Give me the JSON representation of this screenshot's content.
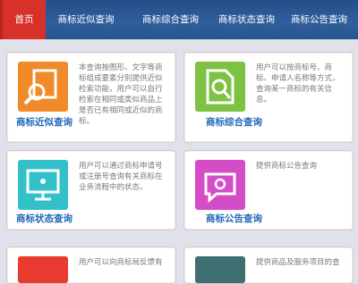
{
  "nav": {
    "items": [
      {
        "label": "首页",
        "active": true
      },
      {
        "label": "商标近似查询"
      },
      {
        "label": "商标综合查询"
      },
      {
        "label": "商标状态查询"
      },
      {
        "label": "商标公告查询"
      }
    ]
  },
  "cards": [
    {
      "title": "商标近似查询",
      "icon": "search-document-icon",
      "color": "#f18a28",
      "desc": "本查询按图形、文字等商标组成要素分别提供近似检索功能，用户可以自行检索在相同或类似商品上是否已有相同或近似的商标。"
    },
    {
      "title": "商标综合查询",
      "icon": "document-search-icon",
      "color": "#7dc242",
      "desc": "用户可以按商标号、商标、申请人名称等方式，查询某一商标的有关信息。"
    },
    {
      "title": "商标状态查询",
      "icon": "monitor-icon",
      "color": "#33c0c8",
      "desc": "用户可以通过商标申请号或注册号查询有关商标在业务流程中的状态。"
    },
    {
      "title": "商标公告查询",
      "icon": "announcement-icon",
      "color": "#d44cc6",
      "desc": "提供商标公告查询"
    },
    {
      "title": "",
      "icon": "partial-icon",
      "color": "#e83a2e",
      "desc": "用户可以向商标局反馈有"
    },
    {
      "title": "",
      "icon": "partial-icon",
      "color": "#3e6e72",
      "desc": "提供商品及服务项目的查"
    }
  ]
}
